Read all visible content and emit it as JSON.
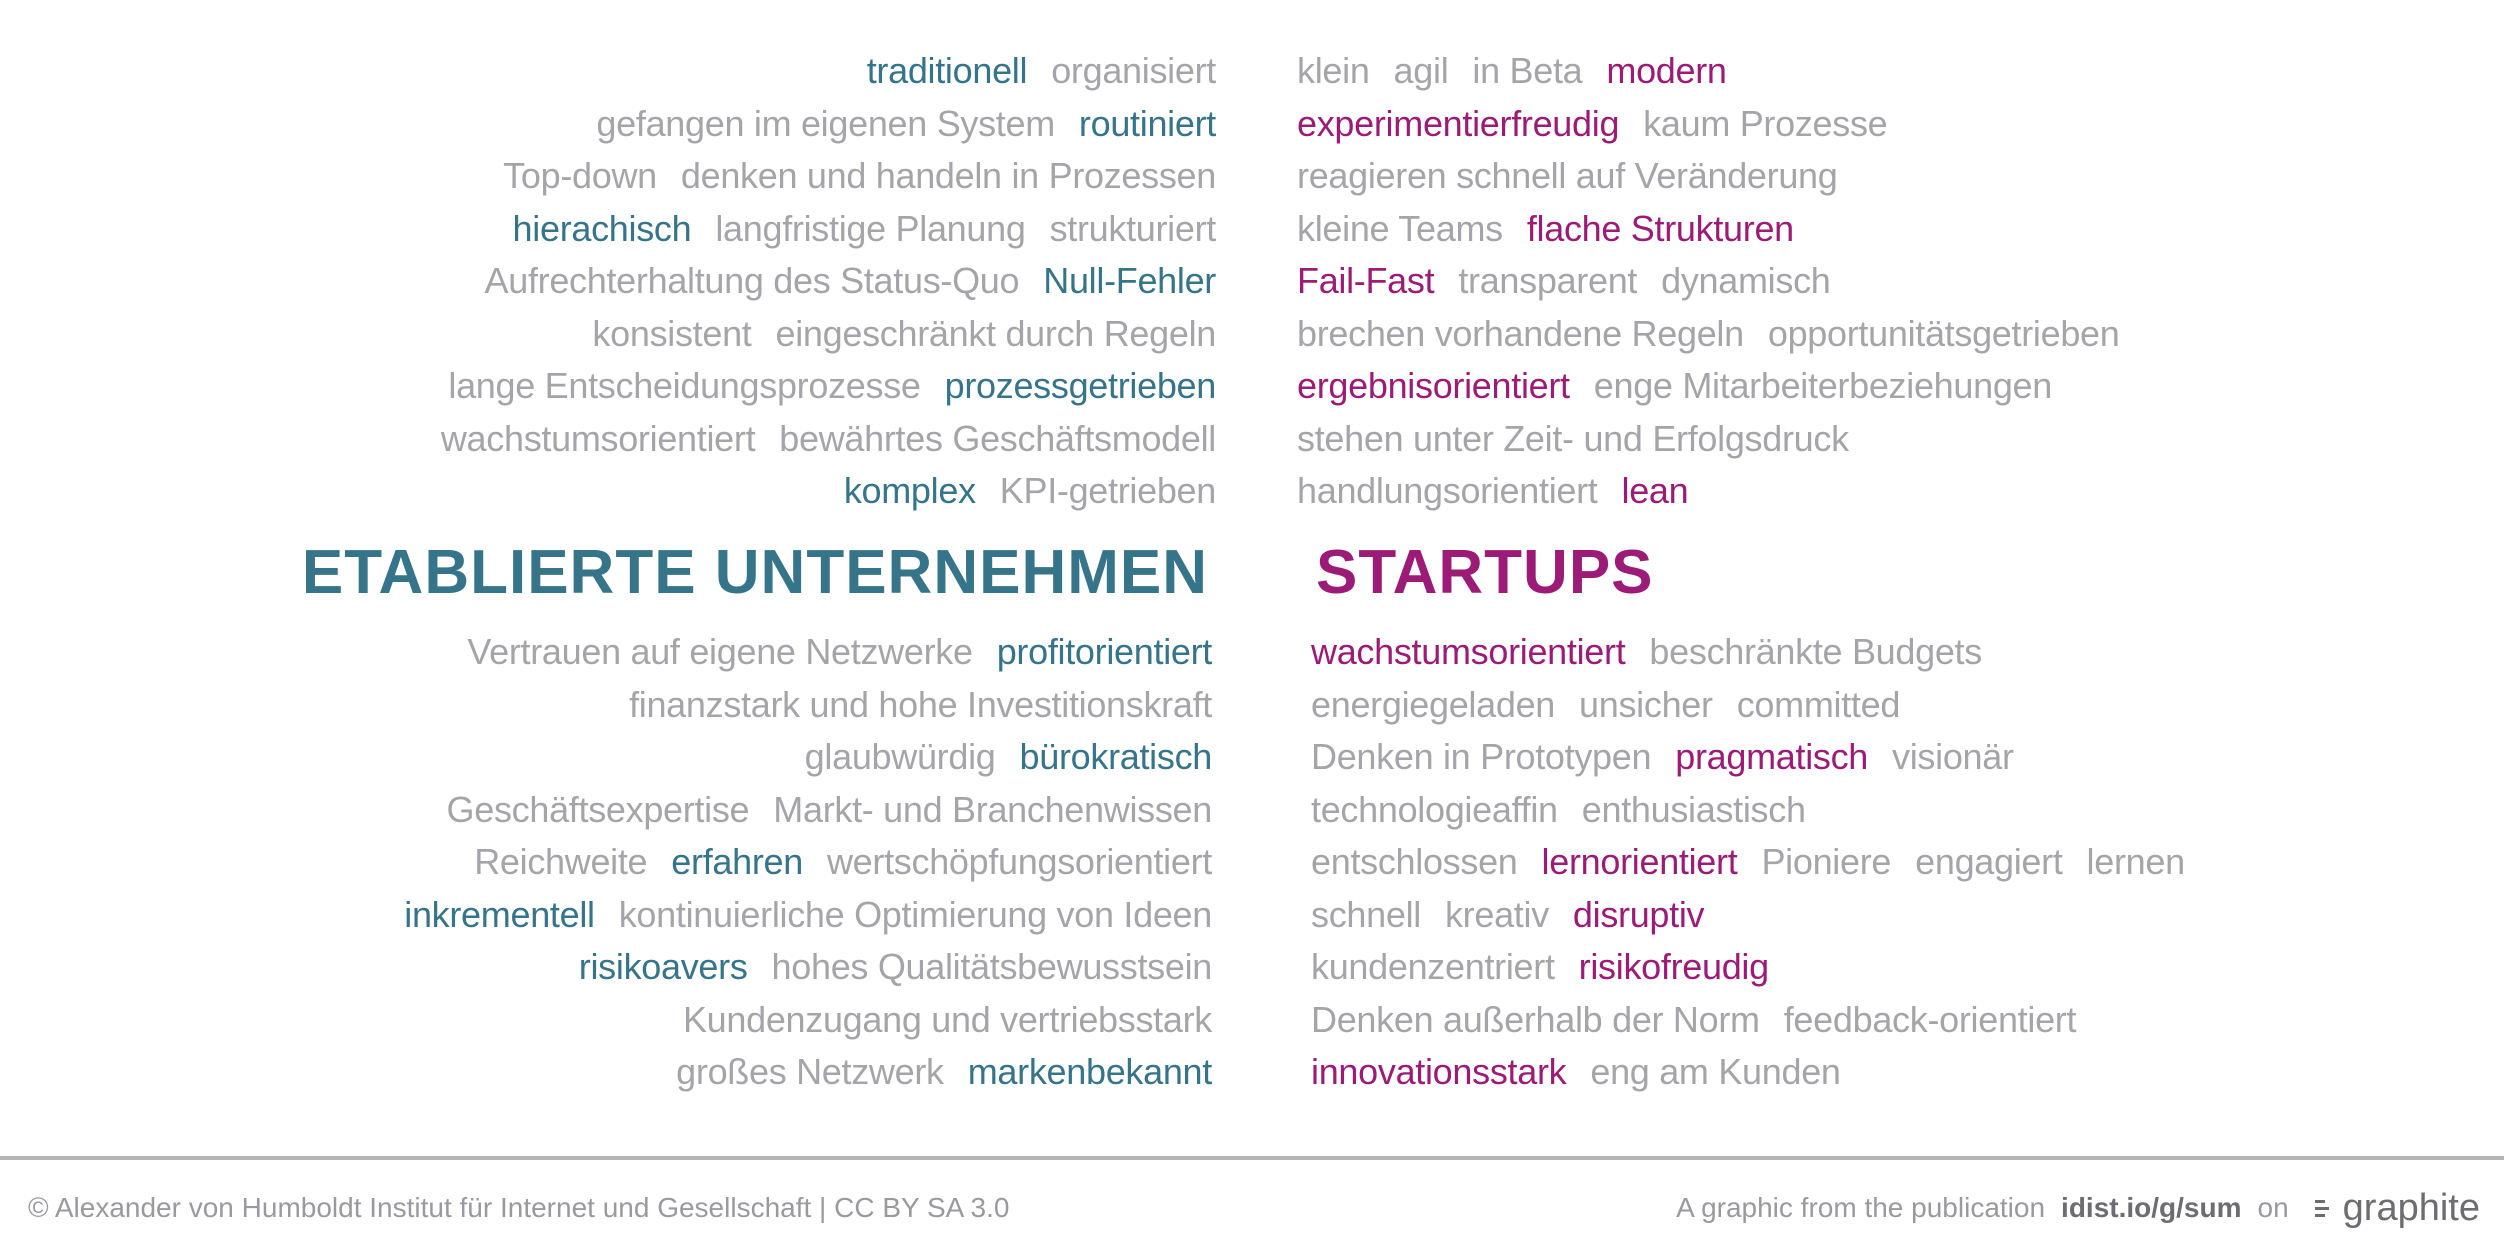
{
  "established": {
    "heading": "ETABLIERTE UNTERNEHMEN",
    "top_lines": [
      [
        {
          "t": "traditionell",
          "h": true
        },
        {
          "t": "organisiert",
          "h": false
        }
      ],
      [
        {
          "t": "gefangen im eigenen System",
          "h": false
        },
        {
          "t": "routiniert",
          "h": true
        }
      ],
      [
        {
          "t": "Top-down",
          "h": false
        },
        {
          "t": "denken und handeln in Prozessen",
          "h": false
        }
      ],
      [
        {
          "t": "hierachisch",
          "h": true
        },
        {
          "t": "langfristige Planung",
          "h": false
        },
        {
          "t": "strukturiert",
          "h": false
        }
      ],
      [
        {
          "t": "Aufrechterhaltung des Status-Quo",
          "h": false
        },
        {
          "t": "Null-Fehler",
          "h": true
        }
      ],
      [
        {
          "t": "konsistent",
          "h": false
        },
        {
          "t": "eingeschränkt durch Regeln",
          "h": false
        }
      ],
      [
        {
          "t": "lange Entscheidungsprozesse",
          "h": false
        },
        {
          "t": "prozessgetrieben",
          "h": true
        }
      ],
      [
        {
          "t": "wachstumsorientiert",
          "h": false
        },
        {
          "t": "bewährtes Geschäftsmodell",
          "h": false
        }
      ],
      [
        {
          "t": "komplex",
          "h": true
        },
        {
          "t": "KPI-getrieben",
          "h": false
        }
      ]
    ],
    "bottom_lines": [
      [
        {
          "t": "Vertrauen auf eigene Netzwerke",
          "h": false
        },
        {
          "t": "profitorientiert",
          "h": true
        }
      ],
      [
        {
          "t": "finanzstark und hohe Investitionskraft",
          "h": false
        }
      ],
      [
        {
          "t": "glaubwürdig",
          "h": false
        },
        {
          "t": "bürokratisch",
          "h": true
        }
      ],
      [
        {
          "t": "Geschäftsexpertise",
          "h": false
        },
        {
          "t": "Markt- und Branchenwissen",
          "h": false
        }
      ],
      [
        {
          "t": "Reichweite",
          "h": false
        },
        {
          "t": "erfahren",
          "h": true
        },
        {
          "t": "wertschöpfungsorientiert",
          "h": false
        }
      ],
      [
        {
          "t": "inkrementell",
          "h": true
        },
        {
          "t": "kontinuierliche Optimierung von Ideen",
          "h": false
        }
      ],
      [
        {
          "t": "risikoavers",
          "h": true
        },
        {
          "t": "hohes Qualitätsbewusstsein",
          "h": false
        }
      ],
      [
        {
          "t": "Kundenzugang und vertriebsstark",
          "h": false
        }
      ],
      [
        {
          "t": "großes Netzwerk",
          "h": false
        },
        {
          "t": "markenbekannt",
          "h": true
        }
      ]
    ]
  },
  "startups": {
    "heading": "STARTUPS",
    "top_lines": [
      [
        {
          "t": "klein",
          "h": false
        },
        {
          "t": "agil",
          "h": false
        },
        {
          "t": "in Beta",
          "h": false
        },
        {
          "t": "modern",
          "h": true
        }
      ],
      [
        {
          "t": "experimentierfreudig",
          "h": true
        },
        {
          "t": "kaum Prozesse",
          "h": false
        }
      ],
      [
        {
          "t": "reagieren schnell auf Veränderung",
          "h": false
        }
      ],
      [
        {
          "t": "kleine Teams",
          "h": false
        },
        {
          "t": "flache Strukturen",
          "h": true
        }
      ],
      [
        {
          "t": "Fail-Fast",
          "h": true
        },
        {
          "t": "transparent",
          "h": false
        },
        {
          "t": "dynamisch",
          "h": false
        }
      ],
      [
        {
          "t": "brechen vorhandene Regeln",
          "h": false
        },
        {
          "t": "opportunitätsgetrieben",
          "h": false
        }
      ],
      [
        {
          "t": "ergebnisorientiert",
          "h": true
        },
        {
          "t": "enge Mitarbeiterbeziehungen",
          "h": false
        }
      ],
      [
        {
          "t": "stehen unter Zeit- und Erfolgsdruck",
          "h": false
        }
      ],
      [
        {
          "t": "handlungsorientiert",
          "h": false
        },
        {
          "t": "lean",
          "h": true
        }
      ]
    ],
    "bottom_lines": [
      [
        {
          "t": "wachstumsorientiert",
          "h": true
        },
        {
          "t": "beschränkte Budgets",
          "h": false
        }
      ],
      [
        {
          "t": "energiegeladen",
          "h": false
        },
        {
          "t": "unsicher",
          "h": false
        },
        {
          "t": "committed",
          "h": false
        }
      ],
      [
        {
          "t": "Denken in Prototypen",
          "h": false
        },
        {
          "t": "pragmatisch",
          "h": true
        },
        {
          "t": "visionär",
          "h": false
        }
      ],
      [
        {
          "t": "technologieaffin",
          "h": false
        },
        {
          "t": "enthusiastisch",
          "h": false
        }
      ],
      [
        {
          "t": "entschlossen",
          "h": false
        },
        {
          "t": "lernorientiert",
          "h": true
        },
        {
          "t": "Pioniere",
          "h": false
        },
        {
          "t": "engagiert",
          "h": false
        },
        {
          "t": "lernen",
          "h": false
        }
      ],
      [
        {
          "t": "schnell",
          "h": false
        },
        {
          "t": "kreativ",
          "h": false
        },
        {
          "t": "disruptiv",
          "h": true
        }
      ],
      [
        {
          "t": "kundenzentriert",
          "h": false
        },
        {
          "t": "risikofreudig",
          "h": true
        }
      ],
      [
        {
          "t": "Denken außerhalb der Norm",
          "h": false
        },
        {
          "t": "feedback-orientiert",
          "h": false
        }
      ],
      [
        {
          "t": "innovationsstark",
          "h": true
        },
        {
          "t": "eng am Kunden",
          "h": false
        }
      ]
    ]
  },
  "colors": {
    "established_accent": "#357489",
    "startup_accent": "#9c1b76",
    "neutral_text": "#a5a5a9"
  },
  "footer": {
    "copyright": "© Alexander von Humboldt Institut für Internet und Gesellschaft | CC BY SA 3.0",
    "publication_prefix": "A graphic from the publication",
    "publication_url": "idist.io/g/sum",
    "on": "on",
    "logo_text": "graphite",
    "logo_icon": "graphite-logo-icon"
  }
}
